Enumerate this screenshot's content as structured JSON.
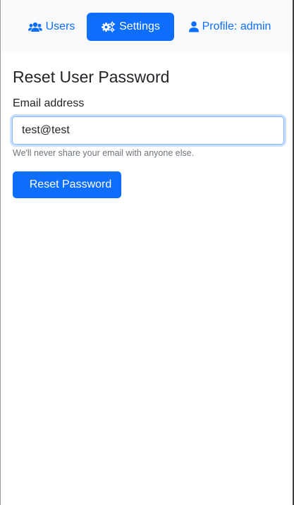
{
  "nav": {
    "users": {
      "label": "Users",
      "icon": "users-icon"
    },
    "settings": {
      "label": "Settings",
      "icon": "cogs-icon",
      "active": true
    },
    "profile": {
      "label": "Profile: admin",
      "icon": "user-icon"
    }
  },
  "page": {
    "title": "Reset User Password"
  },
  "form": {
    "email_label": "Email address",
    "email_value": "test@test",
    "help_text": "We'll never share your email with anyone else.",
    "submit_label": "Reset Password"
  },
  "colors": {
    "primary": "#0d6efd",
    "navbar_bg": "#f8f9fa",
    "text": "#212529",
    "muted": "#6c757d",
    "focus_border": "#86b7fe"
  }
}
